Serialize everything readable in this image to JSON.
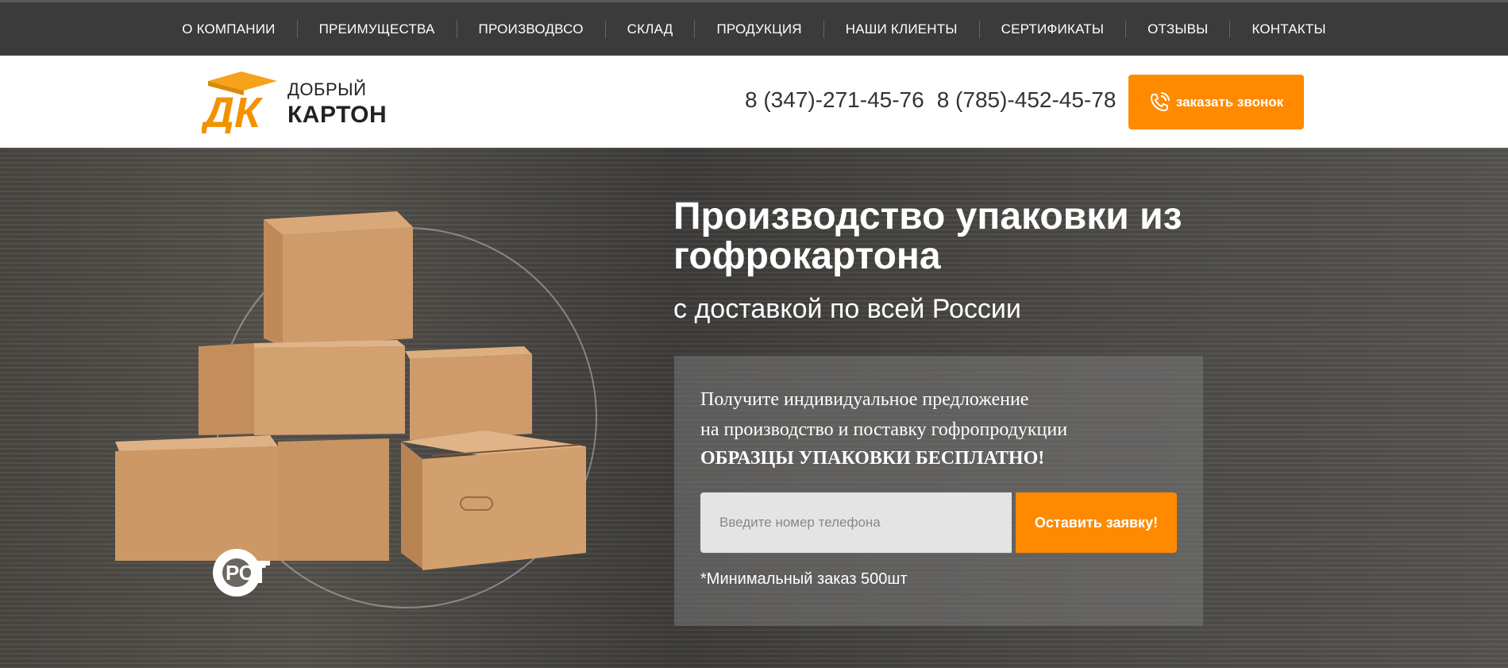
{
  "nav": {
    "items": [
      {
        "label": "О КОМПАНИИ"
      },
      {
        "label": "ПРЕИМУЩЕСТВА"
      },
      {
        "label": "ПРОИЗВОДВСО"
      },
      {
        "label": "СКЛАД"
      },
      {
        "label": "ПРОДУКЦИЯ"
      },
      {
        "label": "НАШИ КЛИЕНТЫ"
      },
      {
        "label": "СЕРТИФИКАТЫ"
      },
      {
        "label": "ОТЗЫВЫ"
      },
      {
        "label": "КОНТАКТЫ"
      }
    ]
  },
  "header": {
    "logo_line1": "ДОБРЫЙ",
    "logo_line2": "КАРТОН",
    "phone1": "8 (347)-271-45-76",
    "phone2": "8 (785)-452-45-78",
    "callback_label": "заказать звонок",
    "callback_icon": "phone-icon"
  },
  "hero": {
    "title": "Производство упаковки из гофрокартона",
    "subtitle": "с доставкой по всей России",
    "offer_line1": "Получите индивидуальное предложение",
    "offer_line2": "на производство и поставку гофропродукции",
    "offer_line3": "ОБРАЗЦЫ УПАКОВКИ БЕСПЛАТНО!",
    "phone_placeholder": "Введите номер телефона",
    "submit_label": "Оставить заявку!",
    "min_order": "*Минимальный заказ 500шт",
    "certification_mark": "РСТ"
  },
  "colors": {
    "accent": "#ff8a00",
    "nav_bg": "#3b3b3b",
    "header_bg": "#ffffff"
  }
}
